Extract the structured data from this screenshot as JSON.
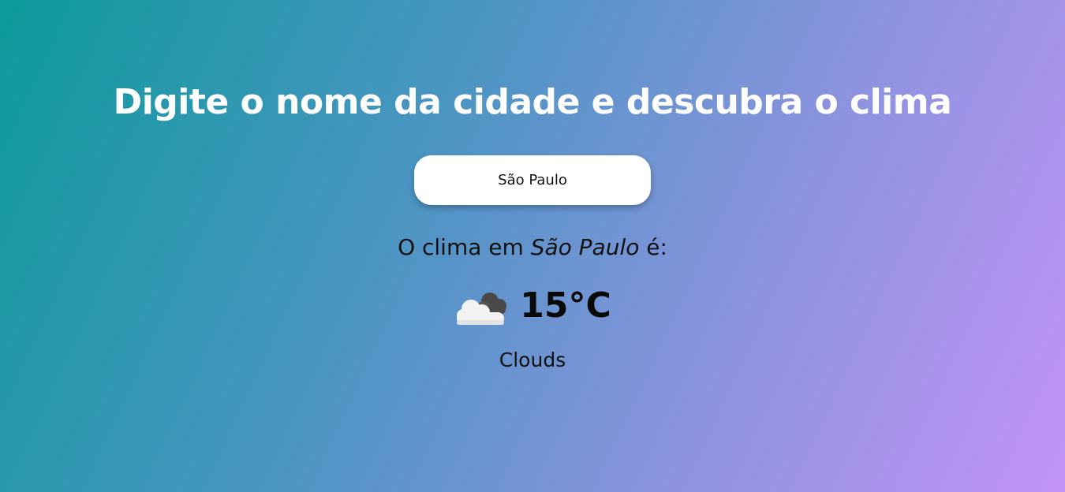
{
  "header": {
    "title": "Digite o nome da cidade e descubra o clima"
  },
  "search": {
    "value": "São Paulo",
    "placeholder": ""
  },
  "result": {
    "prefix": "O clima em ",
    "city": "São Paulo",
    "suffix": " é:",
    "temperature": "15°C",
    "condition": "Clouds",
    "icon": "clouds-icon"
  },
  "colors": {
    "gradient_start": "#0c9a9a",
    "gradient_end": "#c393f7",
    "title_text": "#ffffff",
    "body_text": "#111111"
  }
}
